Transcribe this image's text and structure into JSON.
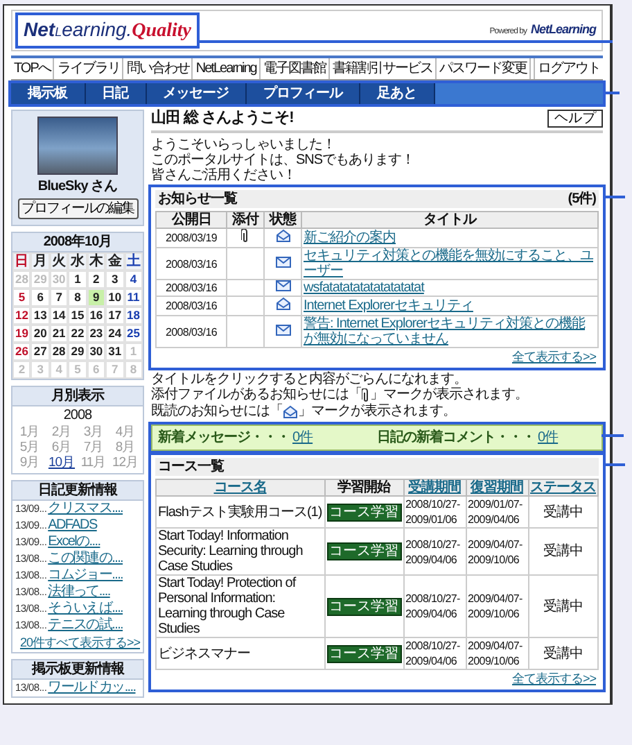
{
  "header": {
    "logo": {
      "prefix": "Net",
      "raised": "L",
      "suffix": "earning.",
      "accent": "Quality",
      "highlighted": true
    },
    "powered_by": "Powered by",
    "powered_brand": "NetLearning"
  },
  "main_nav": [
    "TOPへ",
    "ライブラリ",
    "問い合わせ",
    "NetLearning",
    "電子図書館",
    "書籍割引サービス",
    "パスワード変更",
    "ログアウト"
  ],
  "sub_nav": {
    "highlighted": true,
    "items": [
      "掲示板",
      "日記",
      "メッセージ",
      "プロフィール",
      "足あと"
    ]
  },
  "profile": {
    "name": "BlueSky さん",
    "edit_button": "プロフィールの編集"
  },
  "calendar": {
    "title": "2008年10月",
    "weekdays": [
      "日",
      "月",
      "火",
      "水",
      "木",
      "金",
      "土"
    ],
    "weeks": [
      [
        {
          "day": "28",
          "other_month": true,
          "today": false
        },
        {
          "day": "29",
          "other_month": true,
          "today": false
        },
        {
          "day": "30",
          "other_month": true,
          "today": false
        },
        {
          "day": "1",
          "other_month": false,
          "today": false
        },
        {
          "day": "2",
          "other_month": false,
          "today": false
        },
        {
          "day": "3",
          "other_month": false,
          "today": false
        },
        {
          "day": "4",
          "other_month": false,
          "today": false
        }
      ],
      [
        {
          "day": "5",
          "other_month": false,
          "today": false
        },
        {
          "day": "6",
          "other_month": false,
          "today": false
        },
        {
          "day": "7",
          "other_month": false,
          "today": false
        },
        {
          "day": "8",
          "other_month": false,
          "today": false
        },
        {
          "day": "9",
          "other_month": false,
          "today": true
        },
        {
          "day": "10",
          "other_month": false,
          "today": false
        },
        {
          "day": "11",
          "other_month": false,
          "today": false
        }
      ],
      [
        {
          "day": "12",
          "other_month": false,
          "today": false
        },
        {
          "day": "13",
          "other_month": false,
          "today": false
        },
        {
          "day": "14",
          "other_month": false,
          "today": false
        },
        {
          "day": "15",
          "other_month": false,
          "today": false
        },
        {
          "day": "16",
          "other_month": false,
          "today": false
        },
        {
          "day": "17",
          "other_month": false,
          "today": false
        },
        {
          "day": "18",
          "other_month": false,
          "today": false
        }
      ],
      [
        {
          "day": "19",
          "other_month": false,
          "today": false
        },
        {
          "day": "20",
          "other_month": false,
          "today": false
        },
        {
          "day": "21",
          "other_month": false,
          "today": false
        },
        {
          "day": "22",
          "other_month": false,
          "today": false
        },
        {
          "day": "23",
          "other_month": false,
          "today": false
        },
        {
          "day": "24",
          "other_month": false,
          "today": false
        },
        {
          "day": "25",
          "other_month": false,
          "today": false
        }
      ],
      [
        {
          "day": "26",
          "other_month": false,
          "today": false
        },
        {
          "day": "27",
          "other_month": false,
          "today": false
        },
        {
          "day": "28",
          "other_month": false,
          "today": false
        },
        {
          "day": "29",
          "other_month": false,
          "today": false
        },
        {
          "day": "30",
          "other_month": false,
          "today": false
        },
        {
          "day": "31",
          "other_month": false,
          "today": false
        },
        {
          "day": "1",
          "other_month": true,
          "today": false
        }
      ],
      [
        {
          "day": "2",
          "other_month": true,
          "today": false
        },
        {
          "day": "3",
          "other_month": true,
          "today": false
        },
        {
          "day": "4",
          "other_month": true,
          "today": false
        },
        {
          "day": "5",
          "other_month": true,
          "today": false
        },
        {
          "day": "6",
          "other_month": true,
          "today": false
        },
        {
          "day": "7",
          "other_month": true,
          "today": false
        },
        {
          "day": "8",
          "other_month": true,
          "today": false
        }
      ]
    ]
  },
  "month_view": {
    "title": "月別表示",
    "year": "2008",
    "months": [
      {
        "label": "1月",
        "selected": false
      },
      {
        "label": "2月",
        "selected": false
      },
      {
        "label": "3月",
        "selected": false
      },
      {
        "label": "4月",
        "selected": false
      },
      {
        "label": "5月",
        "selected": false
      },
      {
        "label": "6月",
        "selected": false
      },
      {
        "label": "7月",
        "selected": false
      },
      {
        "label": "8月",
        "selected": false
      },
      {
        "label": "9月",
        "selected": false
      },
      {
        "label": "10月",
        "selected": true
      },
      {
        "label": "11月",
        "selected": false
      },
      {
        "label": "12月",
        "selected": false
      }
    ]
  },
  "diary_updates": {
    "title": "日記更新情報",
    "items": [
      {
        "date": "13/09...",
        "title": "クリスマス...."
      },
      {
        "date": "13/09...",
        "title": "ADFADS"
      },
      {
        "date": "13/09...",
        "title": "Excelの...."
      },
      {
        "date": "13/08...",
        "title": "この関連の...."
      },
      {
        "date": "13/08...",
        "title": "コムジョー...."
      },
      {
        "date": "13/08...",
        "title": "法律って...."
      },
      {
        "date": "13/08...",
        "title": "そういえば...."
      },
      {
        "date": "13/08...",
        "title": "テニスの試...."
      }
    ],
    "more": "20件すべて表示する>>"
  },
  "board_updates": {
    "title": "掲示板更新情報",
    "items": [
      {
        "date": "13/08...",
        "title": "ワールドカッ...."
      }
    ]
  },
  "welcome": {
    "heading": "山田 総 さんようこそ!",
    "help_button": "ヘルプ",
    "lines": [
      "ようこそいらっしゃいました！",
      "このポータルサイトは、SNSでもあります！",
      "皆さんご活用ください！"
    ]
  },
  "notices": {
    "highlighted": true,
    "title": "お知らせ一覧",
    "count": "(5件)",
    "columns": [
      "公開日",
      "添付",
      "状態",
      "タイトル"
    ],
    "rows": [
      {
        "date": "2008/03/19",
        "attachment": true,
        "read": true,
        "title": "新ご紹介の案内"
      },
      {
        "date": "2008/03/16",
        "attachment": false,
        "read": false,
        "title": "セキュリティ対策との機能を無効にすること、ユーザー"
      },
      {
        "date": "2008/03/16",
        "attachment": false,
        "read": false,
        "title": "wsfatatatatatatatatatat"
      },
      {
        "date": "2008/03/16",
        "attachment": false,
        "read": true,
        "title": "Internet Explorerセキュリティ"
      },
      {
        "date": "2008/03/16",
        "attachment": false,
        "read": false,
        "title": "警告: Internet Explorerセキュリティ対策との機能が無効になっていません"
      }
    ],
    "more": "全て表示する>>"
  },
  "notes": [
    {
      "kind": "text",
      "text": "タイトルをクリックすると内容がごらんになれます。"
    },
    {
      "kind": "with_clip",
      "before": "添付ファイルがあるお知らせには「",
      "after": "」マークが表示されます。"
    },
    {
      "kind": "with_envelope",
      "before": "既読のお知らせには「",
      "after": "」マークが表示されます。"
    }
  ],
  "new_items": {
    "highlighted": true,
    "items": [
      {
        "label": "新着メッセージ・・・",
        "count": "0件"
      },
      {
        "label": "日記の新着コメント・・・",
        "count": "0件"
      }
    ]
  },
  "courses": {
    "highlighted": true,
    "title": "コース一覧",
    "columns": [
      {
        "label": "コース名",
        "link": true
      },
      {
        "label": "学習開始",
        "link": false
      },
      {
        "label": "受講期間",
        "link": true
      },
      {
        "label": "復習期間",
        "link": true
      },
      {
        "label": "ステータス",
        "link": true
      }
    ],
    "rows": [
      {
        "name": "Flashテスト実験用コース(1)",
        "action": "コース学習",
        "period": "2008/10/27-2009/01/06",
        "review": "2009/01/07-2009/04/06",
        "status": "受講中"
      },
      {
        "name": "Start Today! Information Security: Learning through Case Studies",
        "action": "コース学習",
        "period": "2008/10/27-2009/04/06",
        "review": "2009/04/07-2009/10/06",
        "status": "受講中"
      },
      {
        "name": "Start Today! Protection of Personal Information: Learning through Case Studies",
        "action": "コース学習",
        "period": "2008/10/27-2009/04/06",
        "review": "2009/04/07-2009/10/06",
        "status": "受講中"
      },
      {
        "name": "ビジネスマナー",
        "action": "コース学習",
        "period": "2008/10/27-2009/04/06",
        "review": "2009/04/07-2009/10/06",
        "status": "受講中"
      }
    ],
    "more": "全て表示する>>"
  }
}
